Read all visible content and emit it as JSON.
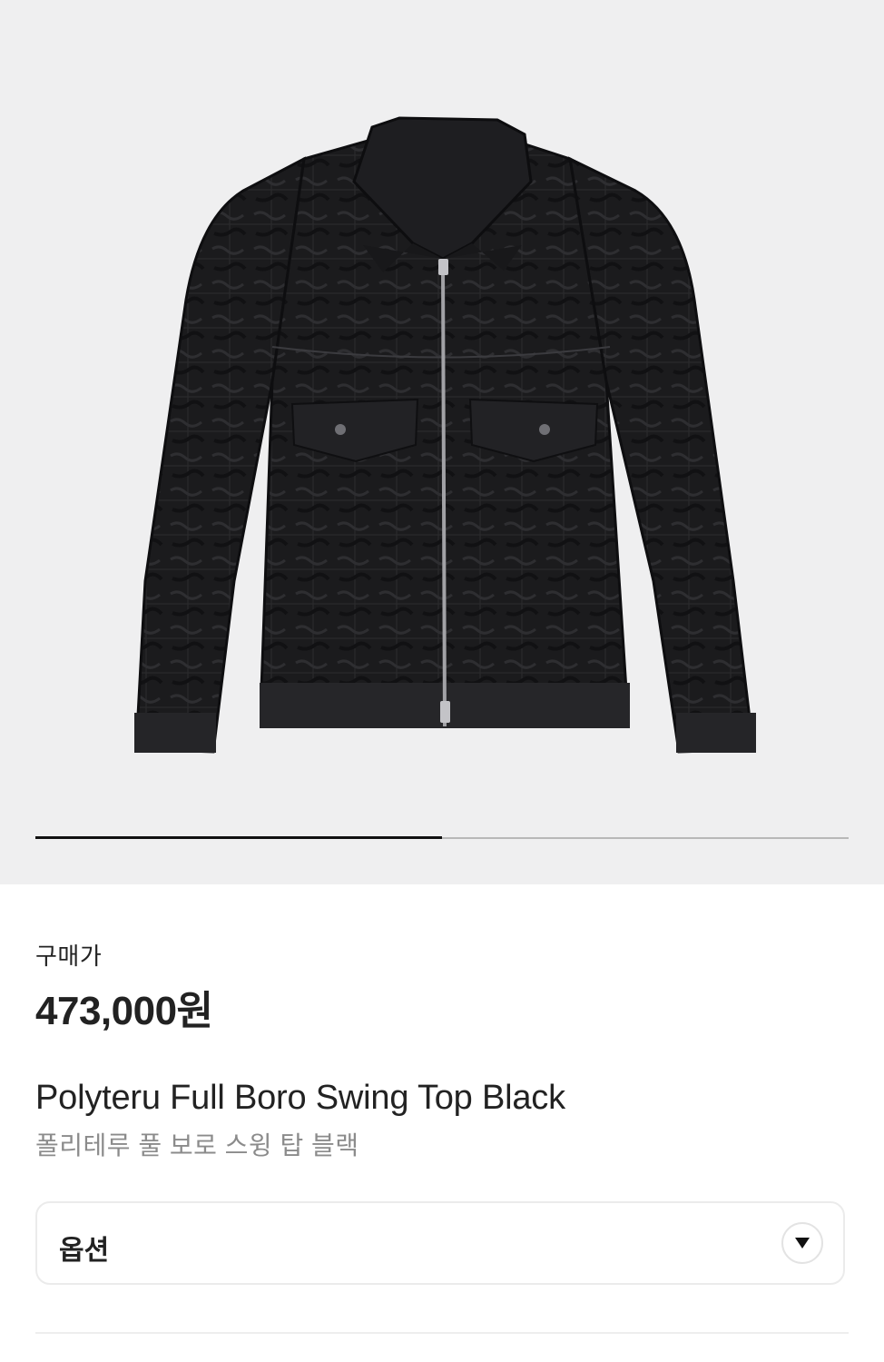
{
  "product": {
    "image_icon": "black-zip-jacket-image",
    "carousel_progress": 0.5,
    "price_label": "구매가",
    "price": "473,000원",
    "name_en": "Polyteru Full Boro Swing Top Black",
    "name_ko": "폴리테루 풀 보로 스윙 탑 블랙"
  },
  "options": {
    "label": "옵션",
    "chevron_icon": "chevron-down-icon"
  },
  "colors": {
    "image_bg": "#efeff0",
    "text_primary": "#222222",
    "text_secondary": "#8b8b8b",
    "progress_active": "#111111",
    "progress_track": "#b8b8b8"
  }
}
